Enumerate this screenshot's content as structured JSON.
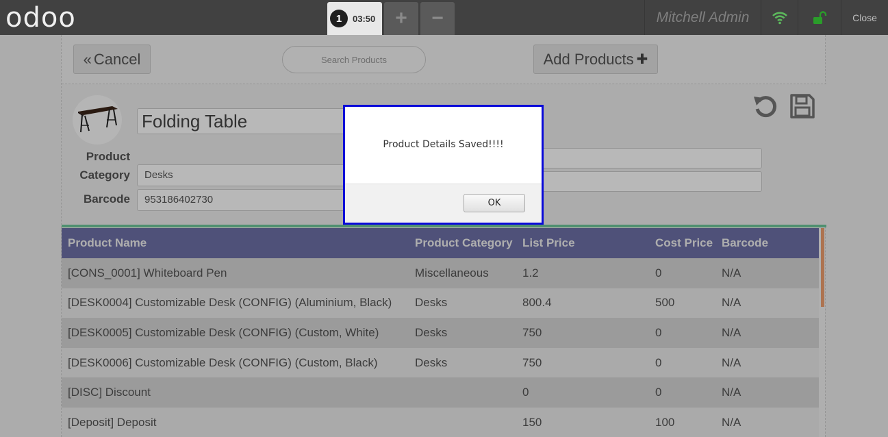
{
  "header": {
    "logo": "odoo",
    "order_number": "1",
    "order_time": "03:50",
    "add_order": "+",
    "remove_order": "−",
    "user_name": "Mitchell Admin",
    "close_label": "Close",
    "icons": {
      "wifi": "wifi-icon",
      "lock": "unlock-icon"
    },
    "colors": {
      "wifi": "#5cb85c",
      "lock": "#2a9d2a"
    }
  },
  "toolbar": {
    "cancel_icon": "«",
    "cancel_label": "Cancel",
    "search_placeholder": "Search Products",
    "add_products_label": "Add Products",
    "add_products_icon": "✚"
  },
  "product": {
    "name": "Folding Table",
    "category_label": "Product Category",
    "category_label_line1": "Product",
    "category_label_line2": "Category",
    "category_value": "Desks",
    "barcode_label": "Barcode",
    "barcode_value": "953186402730"
  },
  "table": {
    "columns": [
      "Product Name",
      "Product Category",
      "List Price",
      "Cost Price",
      "Barcode"
    ],
    "rows": [
      [
        "[CONS_0001] Whiteboard Pen",
        "Miscellaneous",
        "1.2",
        "0",
        "N/A"
      ],
      [
        "[DESK0004] Customizable Desk (CONFIG) (Aluminium, Black)",
        "Desks",
        "800.4",
        "500",
        "N/A"
      ],
      [
        "[DESK0005] Customizable Desk (CONFIG) (Custom, White)",
        "Desks",
        "750",
        "0",
        "N/A"
      ],
      [
        "[DESK0006] Customizable Desk (CONFIG) (Custom, Black)",
        "Desks",
        "750",
        "0",
        "N/A"
      ],
      [
        "[DISC] Discount",
        "",
        "0",
        "0",
        "N/A"
      ],
      [
        "[Deposit] Deposit",
        "",
        "150",
        "100",
        "N/A"
      ]
    ]
  },
  "dialog": {
    "message": "Product Details Saved!!!!",
    "ok_label": "OK"
  }
}
